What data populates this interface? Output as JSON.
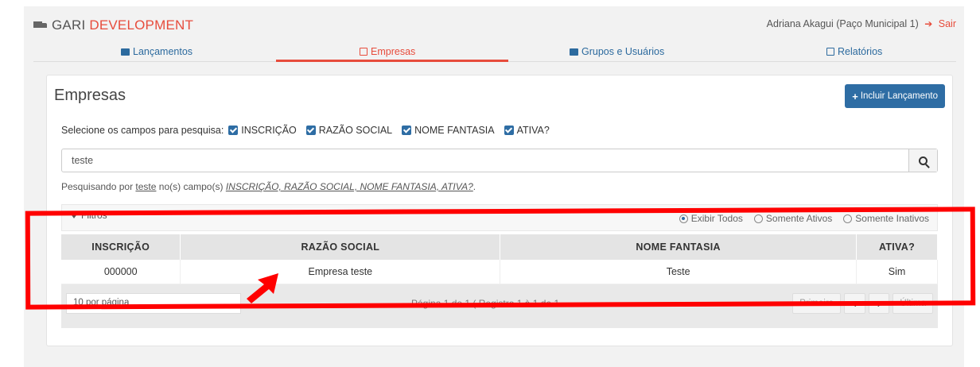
{
  "header": {
    "brand_part1": "GARI",
    "brand_part2": "DEVELOPMENT",
    "user": "Adriana Akagui (Paço Municipal 1)",
    "logout": "Sair"
  },
  "nav": {
    "items": [
      {
        "label": "Lançamentos"
      },
      {
        "label": "Empresas"
      },
      {
        "label": "Grupos e Usuários"
      },
      {
        "label": "Relatórios"
      }
    ],
    "active_color": "#e74c3c",
    "link_color": "#2c6a9e"
  },
  "panel": {
    "title": "Empresas",
    "add_button": "Incluir Lançamento",
    "fields_prompt": "Selecione os campos para pesquisa:",
    "fields": [
      {
        "label": "INSCRIÇÃO",
        "checked": true
      },
      {
        "label": "RAZÃO SOCIAL",
        "checked": true
      },
      {
        "label": "NOME FANTASIA",
        "checked": true
      },
      {
        "label": "ATIVA?",
        "checked": true
      }
    ],
    "search_value": "teste",
    "searching_prefix": "Pesquisando por",
    "searching_term": "teste",
    "searching_middle": "no(s) campo(s)",
    "searching_fields": "INSCRIÇÃO, RAZÃO SOCIAL, NOME FANTASIA, ATIVA?",
    "searching_suffix": ".",
    "filters_label": "Filtros",
    "radio_options": [
      {
        "label": "Exibir Todos",
        "selected": true
      },
      {
        "label": "Somente Ativos",
        "selected": false
      },
      {
        "label": "Somente Inativos",
        "selected": false
      }
    ]
  },
  "table": {
    "headers": [
      "INSCRIÇÃO",
      "RAZÃO SOCIAL",
      "NOME FANTASIA",
      "ATIVA?"
    ],
    "rows": [
      [
        "000000",
        "Empresa teste",
        "Teste",
        "Sim"
      ]
    ]
  },
  "pager": {
    "per_page": "10 por página",
    "info": "Página 1 de 1 ( Registro 1 à 1 de 1",
    "first": "Primeira",
    "prev": "‹",
    "next": "›",
    "last": "Última"
  },
  "colors": {
    "primary": "#2e6da4",
    "accent": "#e74c3c",
    "annotation": "#ff0000"
  }
}
